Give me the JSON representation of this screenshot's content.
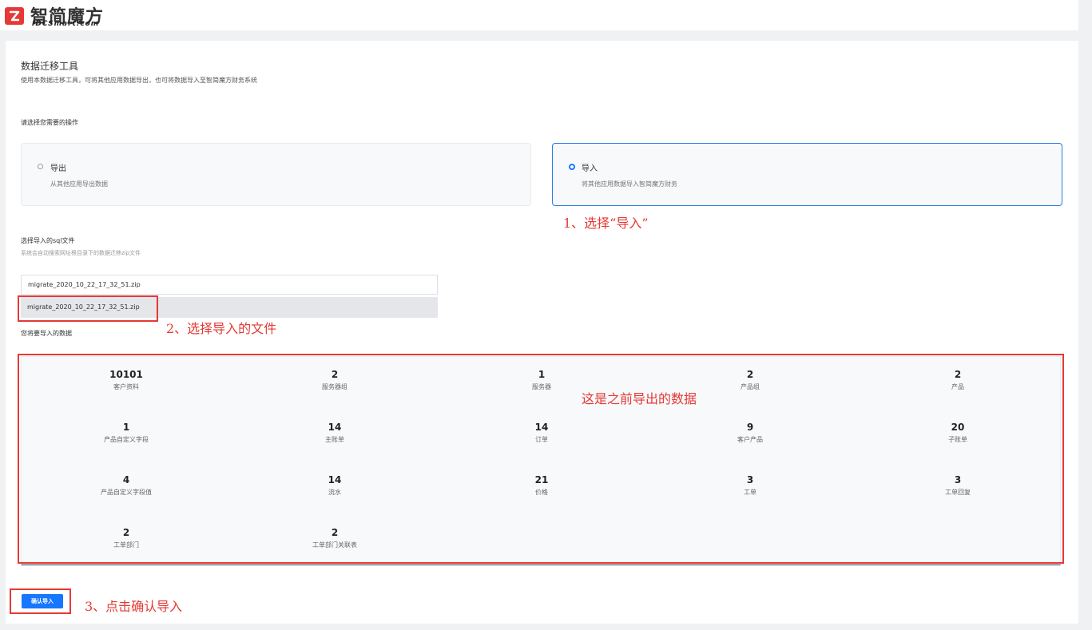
{
  "header": {
    "logo_text": "智简魔方",
    "logo_sub": "IDCSmart.com"
  },
  "page": {
    "title": "数据迁移工具",
    "description": "使用本数据迁移工具，可将其他应用数据导出，也可将数据导入至智简魔方财务系统",
    "select_operation_label": "请选择您需要的操作"
  },
  "operations": [
    {
      "title": "导出",
      "subtitle": "从其他应用导出数据",
      "selected": false
    },
    {
      "title": "导入",
      "subtitle": "将其他应用数据导入智简魔方财务",
      "selected": true
    }
  ],
  "sql": {
    "label": "选择导入的sql文件",
    "hint": "系统会自动搜索网址根目录下的数据迁移zip文件",
    "selected_file": "migrate_2020_10_22_17_32_51.zip",
    "options": [
      "migrate_2020_10_22_17_32_51.zip"
    ]
  },
  "import_data_label": "您将要导入的数据",
  "stats": [
    {
      "num": "10101",
      "label": "客户资料"
    },
    {
      "num": "2",
      "label": "服务器组"
    },
    {
      "num": "1",
      "label": "服务器"
    },
    {
      "num": "2",
      "label": "产品组"
    },
    {
      "num": "2",
      "label": "产品"
    },
    {
      "num": "1",
      "label": "产品自定义字段"
    },
    {
      "num": "14",
      "label": "主账单"
    },
    {
      "num": "14",
      "label": "订单"
    },
    {
      "num": "9",
      "label": "客户产品"
    },
    {
      "num": "20",
      "label": "子账单"
    },
    {
      "num": "4",
      "label": "产品自定义字段值"
    },
    {
      "num": "14",
      "label": "流水"
    },
    {
      "num": "21",
      "label": "价格"
    },
    {
      "num": "3",
      "label": "工单"
    },
    {
      "num": "3",
      "label": "工单回复"
    },
    {
      "num": "2",
      "label": "工单部门"
    },
    {
      "num": "2",
      "label": "工单部门关联表"
    }
  ],
  "confirm_button": "确认导入",
  "annotations": {
    "step1": "1、选择“导入”",
    "step2": "2、选择导入的文件",
    "data_note": "这是之前导出的数据",
    "step3": "3、点击确认导入"
  },
  "colors": {
    "accent": "#1677ff",
    "annotation_red": "#e53935"
  }
}
